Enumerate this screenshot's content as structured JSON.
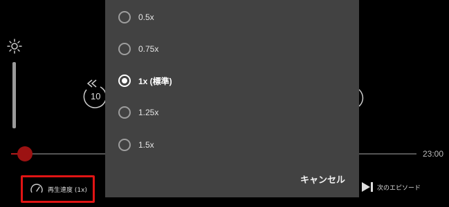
{
  "player": {
    "time_total": "23:00",
    "rewind_seconds": "10",
    "speed_button_label": "再生速度 (1x)",
    "next_episode_label": "次のエピソード",
    "seek_progress": 0.03,
    "icons": {
      "brightness": "sun-icon",
      "rewind": "rewind-10-icon",
      "forward": "forward-10-icon",
      "speed": "speedometer-icon",
      "next": "skip-next-icon"
    },
    "colors": {
      "accent": "#e11414",
      "seek": "#b51c1c"
    }
  },
  "speed_dialog": {
    "options": [
      {
        "label": "0.5x",
        "selected": false
      },
      {
        "label": "0.75x",
        "selected": false
      },
      {
        "label": "1x (標準)",
        "selected": true
      },
      {
        "label": "1.25x",
        "selected": false
      },
      {
        "label": "1.5x",
        "selected": false
      }
    ],
    "cancel_label": "キャンセル"
  }
}
